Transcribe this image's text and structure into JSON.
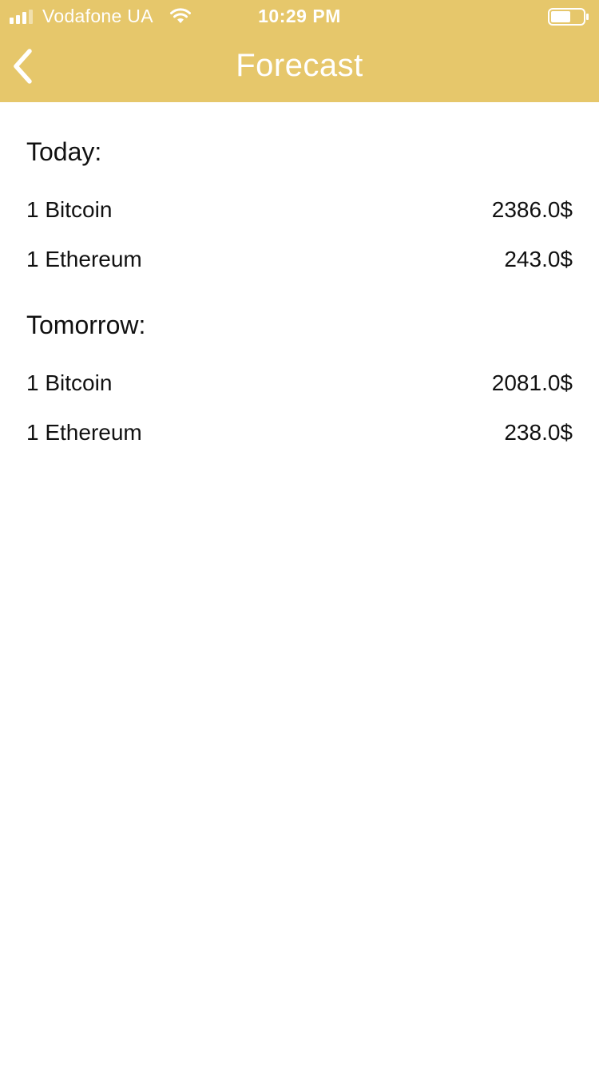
{
  "status_bar": {
    "carrier": "Vodafone UA",
    "time": "10:29 PM",
    "signal_icon": "signal-bars-icon",
    "wifi_icon": "wifi-icon",
    "battery_icon": "battery-icon"
  },
  "nav": {
    "title": "Forecast",
    "back_icon": "chevron-left-icon"
  },
  "colors": {
    "header": "#e6c76b",
    "header_text": "#ffffff",
    "body_text": "#111111",
    "background": "#ffffff"
  },
  "sections": [
    {
      "title": "Today:",
      "rows": [
        {
          "label": "1 Bitcoin",
          "value": "2386.0$"
        },
        {
          "label": "1 Ethereum",
          "value": "243.0$"
        }
      ]
    },
    {
      "title": "Tomorrow:",
      "rows": [
        {
          "label": "1 Bitcoin",
          "value": "2081.0$"
        },
        {
          "label": "1 Ethereum",
          "value": "238.0$"
        }
      ]
    }
  ]
}
